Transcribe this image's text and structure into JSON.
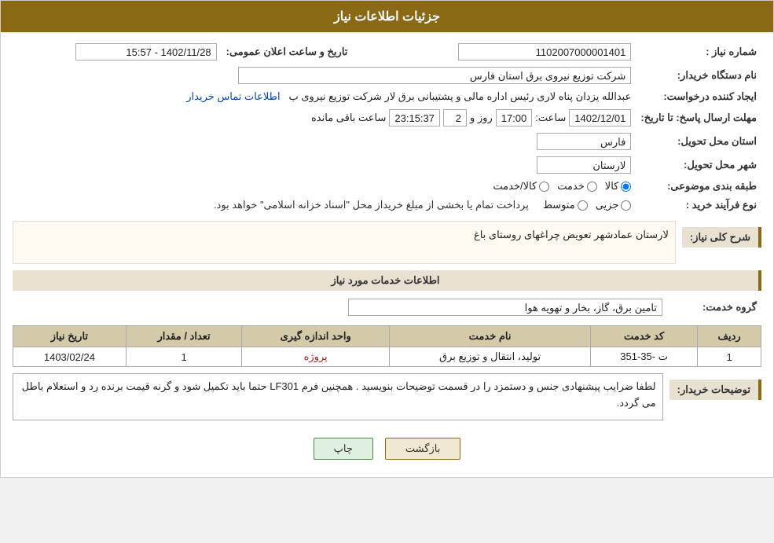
{
  "header": {
    "title": "جزئیات اطلاعات نیاز"
  },
  "fields": {
    "shomara_niaz_label": "شماره نیاز :",
    "shomara_niaz_value": "1102007000001401",
    "nam_dastgah_label": "نام دستگاه خریدار:",
    "nam_dastgah_value": "شرکت توزیع نیروی برق استان فارس",
    "ijad_label": "ایجاد کننده درخواست:",
    "ijad_value": "عبدالله یزدان پناه لاری رئیس اداره مالی و پشتیبانی برق لار شرکت توزیع نیروی ب",
    "ijad_link": "اطلاعات تماس خریدار",
    "mohlet_label": "مهلت ارسال پاسخ: تا تاریخ:",
    "date_value": "1402/12/01",
    "time_label": "ساعت:",
    "time_value": "17:00",
    "rooz_label": "روز و",
    "rooz_value": "2",
    "saat_baqi_label": "ساعت باقی مانده",
    "saat_baqi_value": "23:15:37",
    "ostan_label": "استان محل تحویل:",
    "ostan_value": "فارس",
    "shahr_label": "شهر محل تحویل:",
    "shahr_value": "لارستان",
    "tabaqe_label": "طبقه بندی موضوعی:",
    "tabaqe_options": [
      {
        "label": "کالا",
        "selected": true
      },
      {
        "label": "خدمت",
        "selected": false
      },
      {
        "label": "کالا/خدمت",
        "selected": false
      }
    ],
    "noe_farayand_label": "نوع فرآیند خرید :",
    "noe_farayand_options": [
      {
        "label": "جزیی",
        "selected": false
      },
      {
        "label": "متوسط",
        "selected": false
      }
    ],
    "noe_farayand_note": "پرداخت تمام یا بخشی از مبلغ خریداز محل \"اسناد خزانه اسلامی\" خواهد بود.",
    "sharh_label": "شرح کلی نیاز:",
    "sharh_value": "لارستان عمادشهر تعویض چراغهای روستای باغ",
    "service_section_title": "اطلاعات خدمات مورد نیاز",
    "gorooh_label": "گروه خدمت:",
    "gorooh_value": "تامین برق، گاز، بخار و تهویه هوا",
    "table_headers": [
      "ردیف",
      "کد خدمت",
      "نام خدمت",
      "واحد اندازه گیری",
      "تعداد / مقدار",
      "تاریخ نیاز"
    ],
    "table_rows": [
      {
        "radif": "1",
        "kod": "ت -35-351",
        "name": "تولید، انتقال و توزیع برق",
        "unit": "پروژه",
        "count": "1",
        "date": "1403/02/24"
      }
    ],
    "tossif_label": "توضیحات خریدار:",
    "tossif_value": "لطفا ضرایب پیشنهادی جنس و دستمزد را در قسمت توضیحات بنویسید . همچنین فرم LF301 حتما باید تکمیل شود و گرنه قیمت برنده رد و استعلام باطل می گردد.",
    "btn_back": "بازگشت",
    "btn_print": "چاپ",
    "tarikhe_elam_label": "تاریخ و ساعت اعلان عمومی:",
    "tarikhe_elam_value": "1402/11/28 - 15:57"
  }
}
